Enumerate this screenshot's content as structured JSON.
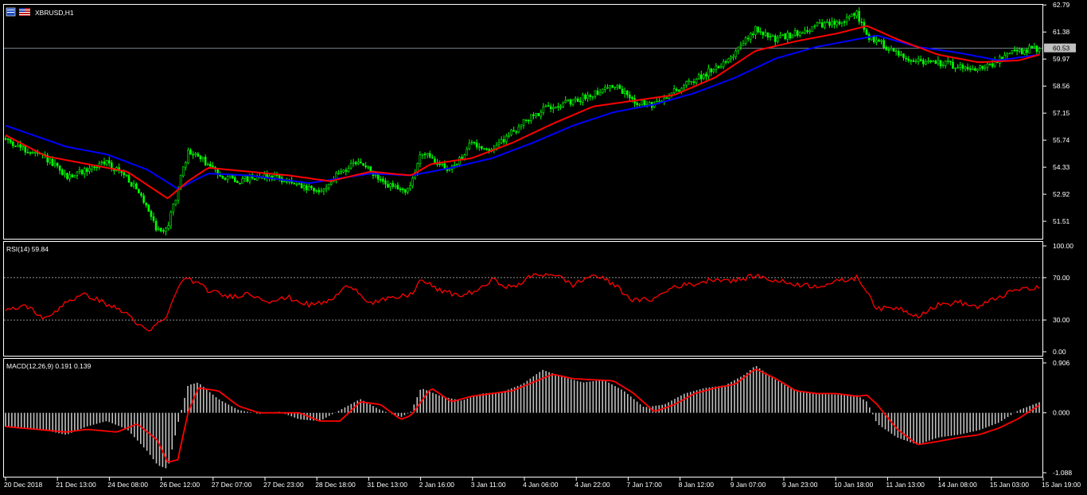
{
  "symbol_label": "XBRUSD,H1",
  "price_tag": "60.53",
  "rsi_title": "RSI(14) 59.84",
  "macd_title": "MACD(12,26,9) 0.191 0.139",
  "colors": {
    "background": "#000000",
    "frame": "#ffffff",
    "bull_candle": "#00ff00",
    "bear_candle": "#00ff00",
    "ma_fast": "#ff0000",
    "ma_slow": "#0000ff",
    "indicator_line": "#ff0000",
    "macd_histogram": "#c0c0c0"
  },
  "chart_data": [
    {
      "type": "candlestick",
      "title": "XBRUSD,H1",
      "ylim": [
        50.6,
        62.8
      ],
      "y_ticks": [
        "62.79",
        "61.38",
        "59.97",
        "58.56",
        "57.15",
        "55.74",
        "54.33",
        "52.92",
        "51.51"
      ],
      "x_ticks": [
        "20 Dec 2018",
        "21 Dec 13:00",
        "24 Dec 08:00",
        "26 Dec 12:00",
        "27 Dec 07:00",
        "27 Dec 23:00",
        "28 Dec 18:00",
        "31 Dec 13:00",
        "2 Jan 16:00",
        "3 Jan 11:00",
        "4 Jan 06:00",
        "4 Jan 22:00",
        "7 Jan 17:00",
        "8 Jan 12:00",
        "9 Jan 07:00",
        "9 Jan 23:00",
        "10 Jan 18:00",
        "11 Jan 13:00",
        "14 Jan 08:00",
        "15 Jan 03:00",
        "15 Jan 19:00"
      ],
      "current_price": 60.53,
      "price_anchors": [
        {
          "x": 0,
          "y": 55.8
        },
        {
          "x": 2,
          "y": 55.2
        },
        {
          "x": 4,
          "y": 54.8
        },
        {
          "x": 6,
          "y": 53.8
        },
        {
          "x": 8,
          "y": 54.2
        },
        {
          "x": 10,
          "y": 54.6
        },
        {
          "x": 12,
          "y": 53.8
        },
        {
          "x": 14,
          "y": 52.3
        },
        {
          "x": 15,
          "y": 51.0
        },
        {
          "x": 16,
          "y": 51.2
        },
        {
          "x": 17,
          "y": 53.2
        },
        {
          "x": 18,
          "y": 55.1
        },
        {
          "x": 19,
          "y": 54.9
        },
        {
          "x": 21,
          "y": 54.0
        },
        {
          "x": 23,
          "y": 53.6
        },
        {
          "x": 25,
          "y": 53.9
        },
        {
          "x": 27,
          "y": 53.8
        },
        {
          "x": 29,
          "y": 53.3
        },
        {
          "x": 31,
          "y": 53.0
        },
        {
          "x": 33,
          "y": 54.1
        },
        {
          "x": 35,
          "y": 54.6
        },
        {
          "x": 37,
          "y": 53.6
        },
        {
          "x": 39,
          "y": 53.1
        },
        {
          "x": 40,
          "y": 53.3
        },
        {
          "x": 41,
          "y": 55.2
        },
        {
          "x": 42,
          "y": 54.7
        },
        {
          "x": 44,
          "y": 54.2
        },
        {
          "x": 46,
          "y": 55.6
        },
        {
          "x": 48,
          "y": 55.2
        },
        {
          "x": 50,
          "y": 56.2
        },
        {
          "x": 52,
          "y": 57.0
        },
        {
          "x": 54,
          "y": 57.6
        },
        {
          "x": 56,
          "y": 57.7
        },
        {
          "x": 58,
          "y": 58.2
        },
        {
          "x": 60,
          "y": 58.6
        },
        {
          "x": 62,
          "y": 57.8
        },
        {
          "x": 64,
          "y": 57.5
        },
        {
          "x": 66,
          "y": 58.3
        },
        {
          "x": 68,
          "y": 58.9
        },
        {
          "x": 70,
          "y": 59.5
        },
        {
          "x": 72,
          "y": 60.3
        },
        {
          "x": 74,
          "y": 61.5
        },
        {
          "x": 76,
          "y": 61.0
        },
        {
          "x": 78,
          "y": 61.3
        },
        {
          "x": 80,
          "y": 61.7
        },
        {
          "x": 82,
          "y": 61.8
        },
        {
          "x": 84,
          "y": 62.3
        },
        {
          "x": 85,
          "y": 61.2
        },
        {
          "x": 87,
          "y": 60.6
        },
        {
          "x": 89,
          "y": 60.0
        },
        {
          "x": 91,
          "y": 59.8
        },
        {
          "x": 93,
          "y": 59.7
        },
        {
          "x": 95,
          "y": 59.5
        },
        {
          "x": 97,
          "y": 59.6
        },
        {
          "x": 99,
          "y": 60.2
        },
        {
          "x": 101,
          "y": 60.5
        },
        {
          "x": 102,
          "y": 60.53
        }
      ],
      "ma_fast": [
        {
          "x": 0,
          "y": 56.0
        },
        {
          "x": 4,
          "y": 54.9
        },
        {
          "x": 8,
          "y": 54.5
        },
        {
          "x": 12,
          "y": 54.1
        },
        {
          "x": 16,
          "y": 52.7
        },
        {
          "x": 18,
          "y": 53.6
        },
        {
          "x": 20,
          "y": 54.3
        },
        {
          "x": 24,
          "y": 54.1
        },
        {
          "x": 28,
          "y": 53.9
        },
        {
          "x": 32,
          "y": 53.6
        },
        {
          "x": 36,
          "y": 54.1
        },
        {
          "x": 40,
          "y": 53.9
        },
        {
          "x": 42,
          "y": 54.5
        },
        {
          "x": 46,
          "y": 54.8
        },
        {
          "x": 50,
          "y": 55.6
        },
        {
          "x": 54,
          "y": 56.6
        },
        {
          "x": 58,
          "y": 57.5
        },
        {
          "x": 62,
          "y": 57.8
        },
        {
          "x": 66,
          "y": 58.1
        },
        {
          "x": 70,
          "y": 59.0
        },
        {
          "x": 74,
          "y": 60.4
        },
        {
          "x": 78,
          "y": 60.9
        },
        {
          "x": 82,
          "y": 61.3
        },
        {
          "x": 85,
          "y": 61.7
        },
        {
          "x": 88,
          "y": 61.0
        },
        {
          "x": 92,
          "y": 60.2
        },
        {
          "x": 96,
          "y": 59.8
        },
        {
          "x": 100,
          "y": 59.9
        },
        {
          "x": 102,
          "y": 60.2
        }
      ],
      "ma_slow": [
        {
          "x": 0,
          "y": 56.5
        },
        {
          "x": 6,
          "y": 55.4
        },
        {
          "x": 10,
          "y": 55.0
        },
        {
          "x": 14,
          "y": 54.2
        },
        {
          "x": 17,
          "y": 53.2
        },
        {
          "x": 20,
          "y": 54.0
        },
        {
          "x": 24,
          "y": 53.9
        },
        {
          "x": 30,
          "y": 53.5
        },
        {
          "x": 36,
          "y": 54.0
        },
        {
          "x": 40,
          "y": 53.9
        },
        {
          "x": 44,
          "y": 54.3
        },
        {
          "x": 48,
          "y": 54.8
        },
        {
          "x": 52,
          "y": 55.6
        },
        {
          "x": 56,
          "y": 56.5
        },
        {
          "x": 60,
          "y": 57.2
        },
        {
          "x": 64,
          "y": 57.6
        },
        {
          "x": 68,
          "y": 58.2
        },
        {
          "x": 72,
          "y": 59.0
        },
        {
          "x": 76,
          "y": 60.0
        },
        {
          "x": 80,
          "y": 60.6
        },
        {
          "x": 84,
          "y": 61.0
        },
        {
          "x": 86,
          "y": 61.2
        },
        {
          "x": 90,
          "y": 60.6
        },
        {
          "x": 94,
          "y": 60.3
        },
        {
          "x": 98,
          "y": 59.9
        },
        {
          "x": 102,
          "y": 60.2
        }
      ]
    },
    {
      "type": "line",
      "title": "RSI(14) 59.84",
      "ylim": [
        0,
        100
      ],
      "y_ticks": [
        "100.00",
        "70.00",
        "30.00",
        "0.00"
      ],
      "levels": [
        70,
        30
      ],
      "anchors": [
        {
          "x": 0,
          "y": 38
        },
        {
          "x": 2,
          "y": 44
        },
        {
          "x": 4,
          "y": 30
        },
        {
          "x": 6,
          "y": 48
        },
        {
          "x": 8,
          "y": 54
        },
        {
          "x": 10,
          "y": 45
        },
        {
          "x": 12,
          "y": 36
        },
        {
          "x": 14,
          "y": 18
        },
        {
          "x": 16,
          "y": 34
        },
        {
          "x": 17,
          "y": 62
        },
        {
          "x": 18,
          "y": 70
        },
        {
          "x": 20,
          "y": 58
        },
        {
          "x": 22,
          "y": 52
        },
        {
          "x": 24,
          "y": 55
        },
        {
          "x": 26,
          "y": 48
        },
        {
          "x": 28,
          "y": 51
        },
        {
          "x": 30,
          "y": 44
        },
        {
          "x": 32,
          "y": 48
        },
        {
          "x": 34,
          "y": 64
        },
        {
          "x": 36,
          "y": 46
        },
        {
          "x": 38,
          "y": 50
        },
        {
          "x": 40,
          "y": 54
        },
        {
          "x": 41,
          "y": 68
        },
        {
          "x": 43,
          "y": 57
        },
        {
          "x": 45,
          "y": 53
        },
        {
          "x": 47,
          "y": 60
        },
        {
          "x": 48,
          "y": 68
        },
        {
          "x": 50,
          "y": 60
        },
        {
          "x": 52,
          "y": 72
        },
        {
          "x": 54,
          "y": 74
        },
        {
          "x": 56,
          "y": 63
        },
        {
          "x": 58,
          "y": 73
        },
        {
          "x": 60,
          "y": 64
        },
        {
          "x": 62,
          "y": 48
        },
        {
          "x": 64,
          "y": 50
        },
        {
          "x": 66,
          "y": 62
        },
        {
          "x": 68,
          "y": 64
        },
        {
          "x": 70,
          "y": 69
        },
        {
          "x": 72,
          "y": 67
        },
        {
          "x": 74,
          "y": 72
        },
        {
          "x": 76,
          "y": 67
        },
        {
          "x": 78,
          "y": 64
        },
        {
          "x": 80,
          "y": 62
        },
        {
          "x": 82,
          "y": 66
        },
        {
          "x": 84,
          "y": 70
        },
        {
          "x": 85,
          "y": 58
        },
        {
          "x": 86,
          "y": 40
        },
        {
          "x": 88,
          "y": 42
        },
        {
          "x": 90,
          "y": 34
        },
        {
          "x": 92,
          "y": 44
        },
        {
          "x": 94,
          "y": 47
        },
        {
          "x": 96,
          "y": 42
        },
        {
          "x": 98,
          "y": 52
        },
        {
          "x": 100,
          "y": 59
        },
        {
          "x": 102,
          "y": 59.84
        }
      ]
    },
    {
      "type": "bar+line",
      "title": "MACD(12,26,9) 0.191 0.139",
      "ylim": [
        -1.088,
        0.906
      ],
      "y_ticks": [
        "0.906",
        "0.000",
        "-1.088"
      ],
      "histogram_anchors": [
        {
          "x": 0,
          "y": -0.25
        },
        {
          "x": 4,
          "y": -0.32
        },
        {
          "x": 6,
          "y": -0.4
        },
        {
          "x": 8,
          "y": -0.25
        },
        {
          "x": 10,
          "y": -0.15
        },
        {
          "x": 12,
          "y": -0.3
        },
        {
          "x": 14,
          "y": -0.7
        },
        {
          "x": 15,
          "y": -0.95
        },
        {
          "x": 16,
          "y": -1.02
        },
        {
          "x": 17,
          "y": -0.2
        },
        {
          "x": 18,
          "y": 0.5
        },
        {
          "x": 19,
          "y": 0.55
        },
        {
          "x": 21,
          "y": 0.25
        },
        {
          "x": 23,
          "y": 0.05
        },
        {
          "x": 25,
          "y": -0.02
        },
        {
          "x": 27,
          "y": 0.02
        },
        {
          "x": 29,
          "y": -0.12
        },
        {
          "x": 31,
          "y": -0.15
        },
        {
          "x": 33,
          "y": 0.05
        },
        {
          "x": 35,
          "y": 0.25
        },
        {
          "x": 37,
          "y": 0.05
        },
        {
          "x": 39,
          "y": -0.08
        },
        {
          "x": 40,
          "y": 0.02
        },
        {
          "x": 41,
          "y": 0.45
        },
        {
          "x": 43,
          "y": 0.3
        },
        {
          "x": 45,
          "y": 0.22
        },
        {
          "x": 47,
          "y": 0.35
        },
        {
          "x": 49,
          "y": 0.38
        },
        {
          "x": 51,
          "y": 0.52
        },
        {
          "x": 53,
          "y": 0.78
        },
        {
          "x": 55,
          "y": 0.65
        },
        {
          "x": 57,
          "y": 0.55
        },
        {
          "x": 59,
          "y": 0.6
        },
        {
          "x": 61,
          "y": 0.4
        },
        {
          "x": 63,
          "y": 0.1
        },
        {
          "x": 65,
          "y": 0.15
        },
        {
          "x": 67,
          "y": 0.35
        },
        {
          "x": 69,
          "y": 0.45
        },
        {
          "x": 71,
          "y": 0.5
        },
        {
          "x": 73,
          "y": 0.7
        },
        {
          "x": 74,
          "y": 0.86
        },
        {
          "x": 76,
          "y": 0.6
        },
        {
          "x": 78,
          "y": 0.4
        },
        {
          "x": 80,
          "y": 0.35
        },
        {
          "x": 82,
          "y": 0.33
        },
        {
          "x": 84,
          "y": 0.32
        },
        {
          "x": 85,
          "y": 0.2
        },
        {
          "x": 86,
          "y": -0.2
        },
        {
          "x": 88,
          "y": -0.45
        },
        {
          "x": 90,
          "y": -0.58
        },
        {
          "x": 92,
          "y": -0.45
        },
        {
          "x": 94,
          "y": -0.4
        },
        {
          "x": 96,
          "y": -0.32
        },
        {
          "x": 98,
          "y": -0.18
        },
        {
          "x": 100,
          "y": 0.05
        },
        {
          "x": 102,
          "y": 0.191
        }
      ],
      "signal_anchors": [
        {
          "x": 0,
          "y": -0.25
        },
        {
          "x": 3,
          "y": -0.3
        },
        {
          "x": 6,
          "y": -0.35
        },
        {
          "x": 8,
          "y": -0.3
        },
        {
          "x": 11,
          "y": -0.35
        },
        {
          "x": 13,
          "y": -0.2
        },
        {
          "x": 15,
          "y": -0.5
        },
        {
          "x": 16,
          "y": -0.9
        },
        {
          "x": 17,
          "y": -0.85
        },
        {
          "x": 18,
          "y": 0.0
        },
        {
          "x": 19,
          "y": 0.45
        },
        {
          "x": 21,
          "y": 0.4
        },
        {
          "x": 23,
          "y": 0.12
        },
        {
          "x": 25,
          "y": 0.0
        },
        {
          "x": 27,
          "y": 0.0
        },
        {
          "x": 29,
          "y": 0.0
        },
        {
          "x": 31,
          "y": -0.15
        },
        {
          "x": 33,
          "y": -0.15
        },
        {
          "x": 35,
          "y": 0.2
        },
        {
          "x": 37,
          "y": 0.15
        },
        {
          "x": 39,
          "y": -0.12
        },
        {
          "x": 40,
          "y": -0.05
        },
        {
          "x": 42,
          "y": 0.45
        },
        {
          "x": 44,
          "y": 0.2
        },
        {
          "x": 46,
          "y": 0.3
        },
        {
          "x": 48,
          "y": 0.35
        },
        {
          "x": 50,
          "y": 0.4
        },
        {
          "x": 52,
          "y": 0.55
        },
        {
          "x": 54,
          "y": 0.7
        },
        {
          "x": 56,
          "y": 0.62
        },
        {
          "x": 58,
          "y": 0.6
        },
        {
          "x": 60,
          "y": 0.58
        },
        {
          "x": 62,
          "y": 0.35
        },
        {
          "x": 64,
          "y": 0.02
        },
        {
          "x": 66,
          "y": 0.15
        },
        {
          "x": 68,
          "y": 0.35
        },
        {
          "x": 70,
          "y": 0.45
        },
        {
          "x": 72,
          "y": 0.52
        },
        {
          "x": 74,
          "y": 0.8
        },
        {
          "x": 76,
          "y": 0.62
        },
        {
          "x": 78,
          "y": 0.4
        },
        {
          "x": 80,
          "y": 0.35
        },
        {
          "x": 82,
          "y": 0.35
        },
        {
          "x": 84,
          "y": 0.3
        },
        {
          "x": 85,
          "y": 0.32
        },
        {
          "x": 86,
          "y": 0.15
        },
        {
          "x": 88,
          "y": -0.3
        },
        {
          "x": 90,
          "y": -0.58
        },
        {
          "x": 92,
          "y": -0.52
        },
        {
          "x": 94,
          "y": -0.45
        },
        {
          "x": 96,
          "y": -0.4
        },
        {
          "x": 98,
          "y": -0.28
        },
        {
          "x": 100,
          "y": -0.1
        },
        {
          "x": 102,
          "y": 0.139
        }
      ]
    }
  ]
}
